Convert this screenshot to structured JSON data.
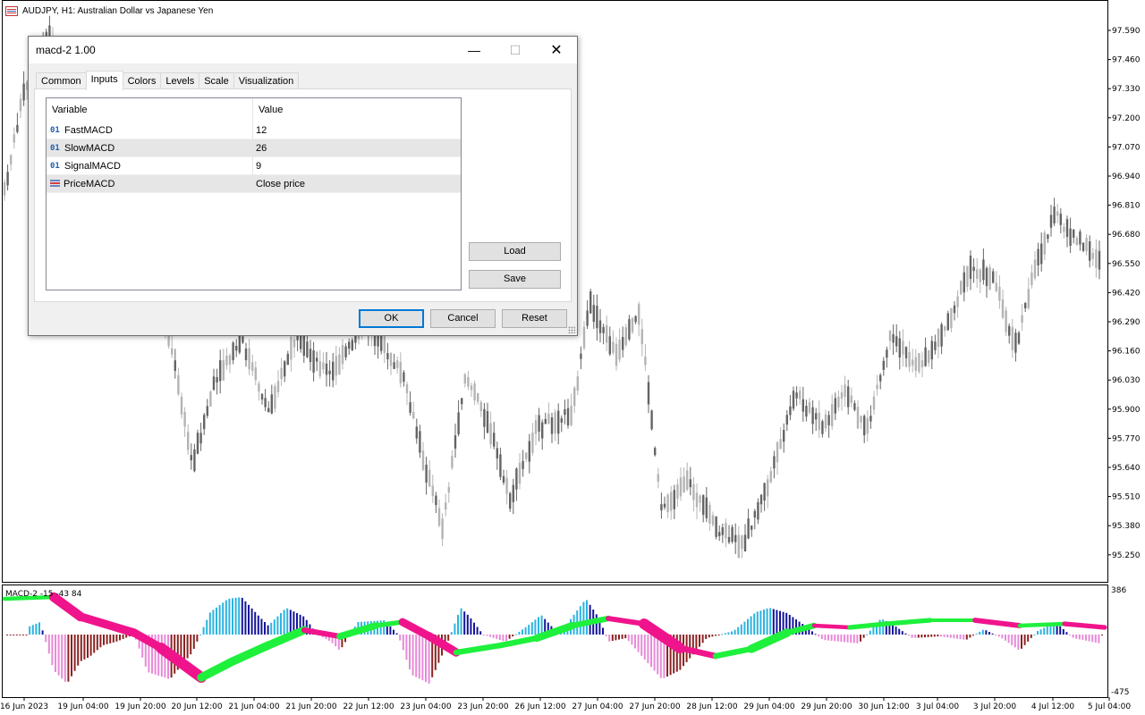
{
  "chart": {
    "title": "AUDJPY, H1:  Australian Dollar vs Japanese Yen",
    "price_levels": [
      "97.590",
      "97.460",
      "97.330",
      "97.200",
      "97.070",
      "96.940",
      "96.810",
      "96.680",
      "96.550",
      "96.420",
      "96.290",
      "96.160",
      "96.030",
      "95.900",
      "95.770",
      "95.640",
      "95.510",
      "95.380",
      "95.250"
    ],
    "time_labels": [
      "16 Jun 2023",
      "19 Jun 04:00",
      "19 Jun 20:00",
      "20 Jun 12:00",
      "21 Jun 04:00",
      "21 Jun 20:00",
      "22 Jun 12:00",
      "23 Jun 04:00",
      "23 Jun 20:00",
      "26 Jun 12:00",
      "27 Jun 04:00",
      "27 Jun 20:00",
      "28 Jun 12:00",
      "29 Jun 04:00",
      "29 Jun 20:00",
      "30 Jun 12:00",
      "3 Jul 04:00",
      "3 Jul 20:00",
      "4 Jul 12:00",
      "5 Jul 04:00"
    ],
    "indicator": {
      "label": "MACD-2 -15 -43 84",
      "scale_top": "386",
      "scale_bottom": "-475"
    },
    "colors": {
      "bull_candle": "#b4b4b4",
      "bear_candle": "#646464",
      "hist_dark_blue": "#14149a",
      "hist_light_blue": "#2cb4e0",
      "hist_dark_red": "#8c2222",
      "hist_pink": "#e88ad8",
      "band_pink": "#f0148c",
      "band_green": "#1ef03c"
    }
  },
  "dialog": {
    "title": "macd-2 1.00",
    "window_buttons": {
      "minimize": "—",
      "maximize": "☐",
      "close": "✕"
    },
    "tabs": [
      {
        "label": "Common",
        "active": false
      },
      {
        "label": "Inputs",
        "active": true
      },
      {
        "label": "Colors",
        "active": false
      },
      {
        "label": "Levels",
        "active": false
      },
      {
        "label": "Scale",
        "active": false
      },
      {
        "label": "Visualization",
        "active": false
      }
    ],
    "grid": {
      "header": {
        "variable": "Variable",
        "value": "Value"
      },
      "rows": [
        {
          "type_icon": "01",
          "variable": "FastMACD",
          "value": "12"
        },
        {
          "type_icon": "01",
          "variable": "SlowMACD",
          "value": "26"
        },
        {
          "type_icon": "01",
          "variable": "SignalMACD",
          "value": "9"
        },
        {
          "type_icon": "enum-icon",
          "variable": "PriceMACD",
          "value": "Close price"
        }
      ]
    },
    "buttons": {
      "load": "Load",
      "save": "Save",
      "ok": "OK",
      "cancel": "Cancel",
      "reset": "Reset"
    }
  }
}
